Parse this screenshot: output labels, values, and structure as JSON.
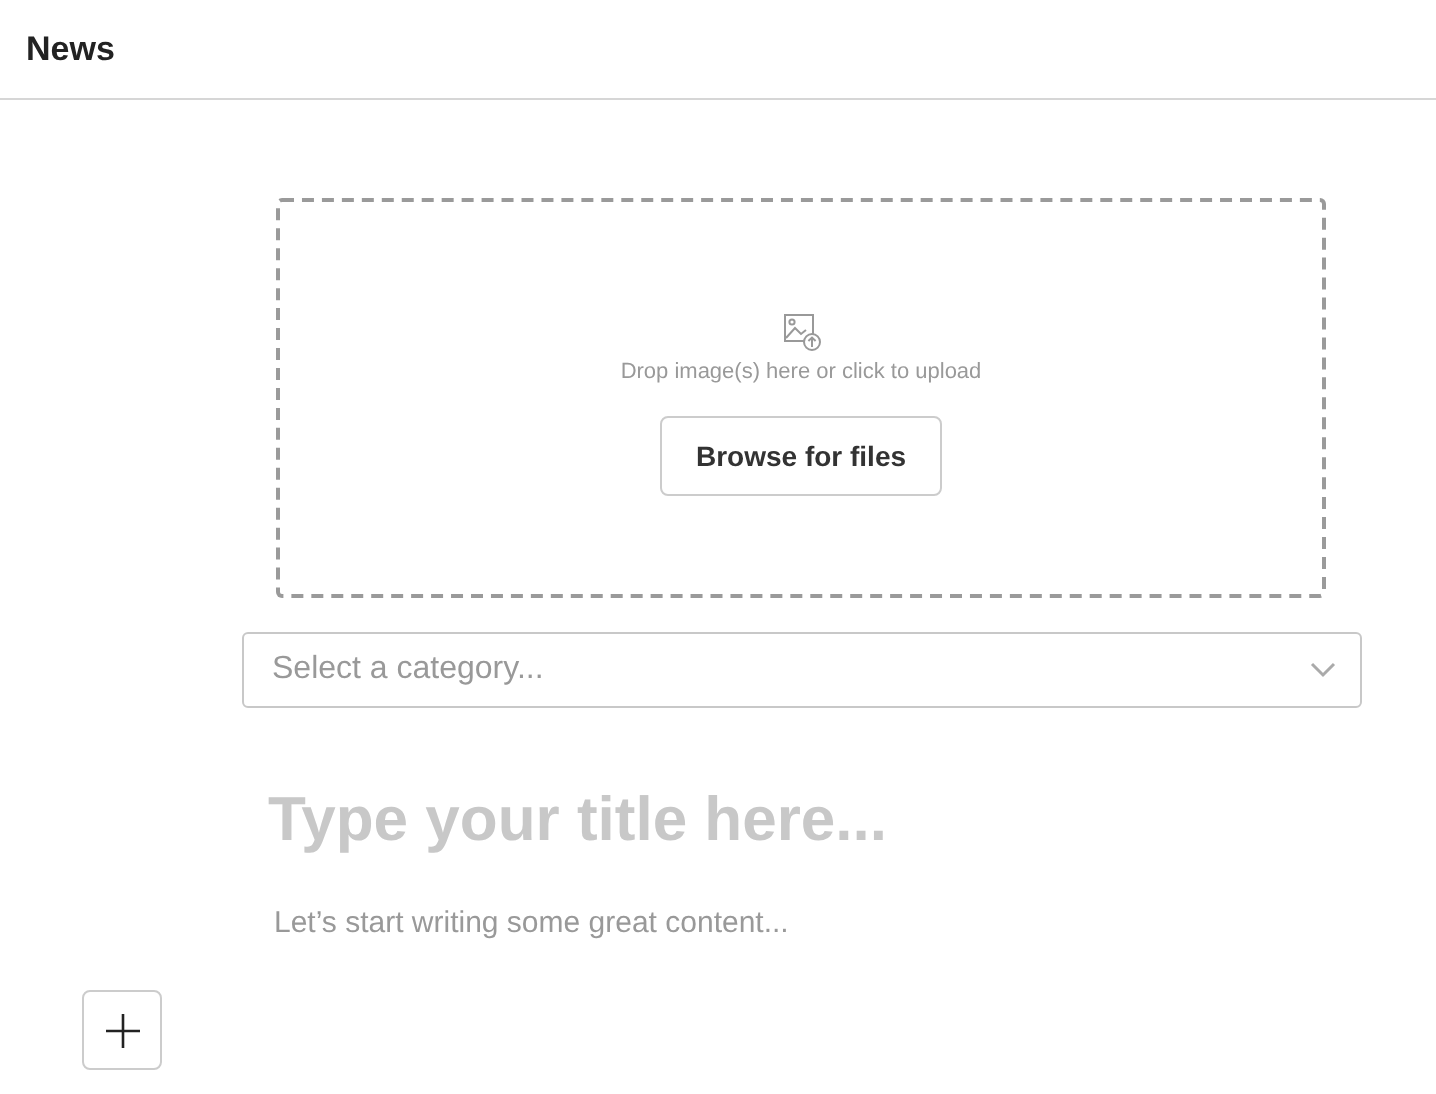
{
  "header": {
    "title": "News"
  },
  "upload": {
    "hint": "Drop image(s) here or click to upload",
    "button": "Browse for files"
  },
  "category": {
    "placeholder": "Select a category..."
  },
  "title_field": {
    "placeholder": "Type your title here..."
  },
  "content_field": {
    "placeholder": "Let’s start writing some great content..."
  }
}
